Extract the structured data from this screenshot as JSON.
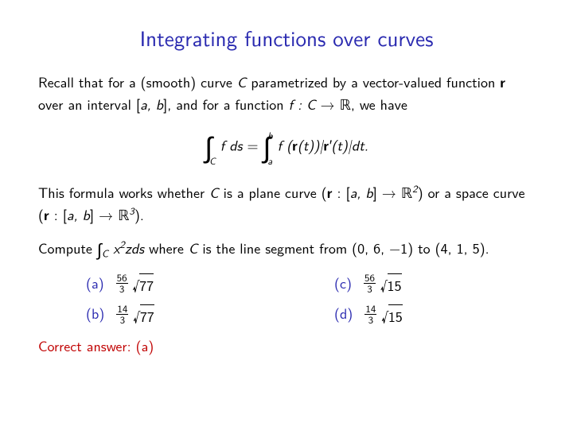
{
  "title": "Integrating functions over curves",
  "p1_a": "Recall that for a (smooth) curve ",
  "p1_b": " parametrized by a vector-valued function ",
  "p1_c": " over an interval [",
  "p1_d": "], and for a function ",
  "p1_e": ", we have",
  "sym_C": "C",
  "sym_r": "r",
  "sym_a": "a",
  "sym_b": "b",
  "sym_ab": "a, b",
  "sym_f": "f",
  "sym_colon": " : ",
  "sym_arrow": " → ",
  "sym_R": "ℝ",
  "formula_fds": "f  ds",
  "formula_eq": " = ",
  "formula_rhs_a": "f (",
  "formula_rhs_b": "(t))|",
  "formula_rhs_c": "′(t)|dt.",
  "p2_a": "This formula works whether ",
  "p2_b": " is a plane curve (",
  "p2_c": " : [",
  "p2_d": "] → ",
  "p2_e": ") or a space curve (",
  "p2_f": ").",
  "exp2": "2",
  "exp3": "3",
  "p3_a": "Compute ",
  "p3_b": "zds",
  "p3_c": " where ",
  "p3_d": " is the line segment from (0, 6, −1) to (4, 1, 5).",
  "p3_x": "x",
  "opts": {
    "a": {
      "label": "(a)",
      "num": "56",
      "den": "3",
      "rad": "77"
    },
    "b": {
      "label": "(b)",
      "num": "14",
      "den": "3",
      "rad": "77"
    },
    "c": {
      "label": "(c)",
      "num": "56",
      "den": "3",
      "rad": "15"
    },
    "d": {
      "label": "(d)",
      "num": "14",
      "den": "3",
      "rad": "15"
    }
  },
  "answer": "Correct answer: (a)"
}
